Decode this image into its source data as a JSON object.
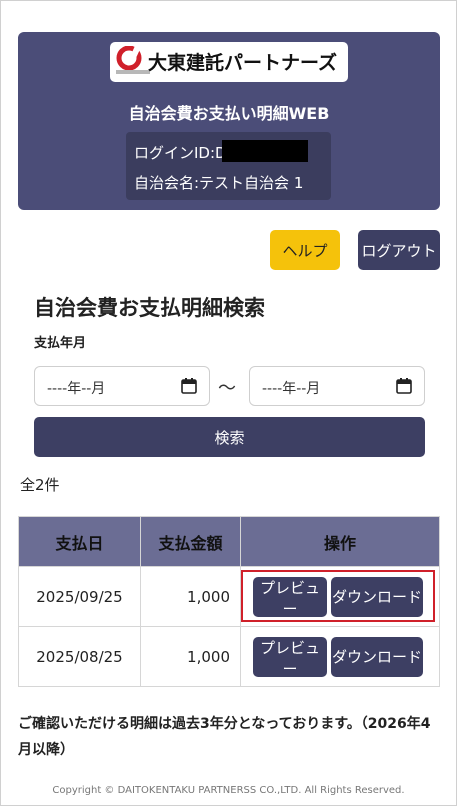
{
  "header": {
    "logo_text": "大東建託パートナーズ",
    "app_title": "自治会費お支払い明細WEB",
    "login_id_label": "ログインID:D",
    "association_name": "自治会名:テスト自治会 1"
  },
  "toolbar": {
    "help_label": "ヘルプ",
    "logout_label": "ログアウト"
  },
  "search": {
    "title": "自治会費お支払明細検索",
    "field_label": "支払年月",
    "from_value": "----年--月",
    "to_value": "----年--月",
    "range_separator": "〜",
    "button_label": "検索"
  },
  "results": {
    "count_text": "全2件",
    "columns": [
      "支払日",
      "支払金額",
      "操作"
    ],
    "rows": [
      {
        "date": "2025/09/25",
        "amount": "1,000",
        "preview_label": "プレビュー",
        "download_label": "ダウンロード"
      },
      {
        "date": "2025/08/25",
        "amount": "1,000",
        "preview_label": "プレビュー",
        "download_label": "ダウンロード"
      }
    ]
  },
  "note": "ご確認いただける明細は過去3年分となっております。（2026年4月以降）",
  "footer": {
    "copyright": "Copyright © DAITOKENTAKU PARTNERSS CO.,LTD. All Rights Reserved."
  },
  "colors": {
    "header_bg": "#4b4d78",
    "primary_button": "#3d3f63",
    "help_button": "#f5c20b",
    "table_header": "#6b6d94",
    "highlight": "#d0202a"
  }
}
